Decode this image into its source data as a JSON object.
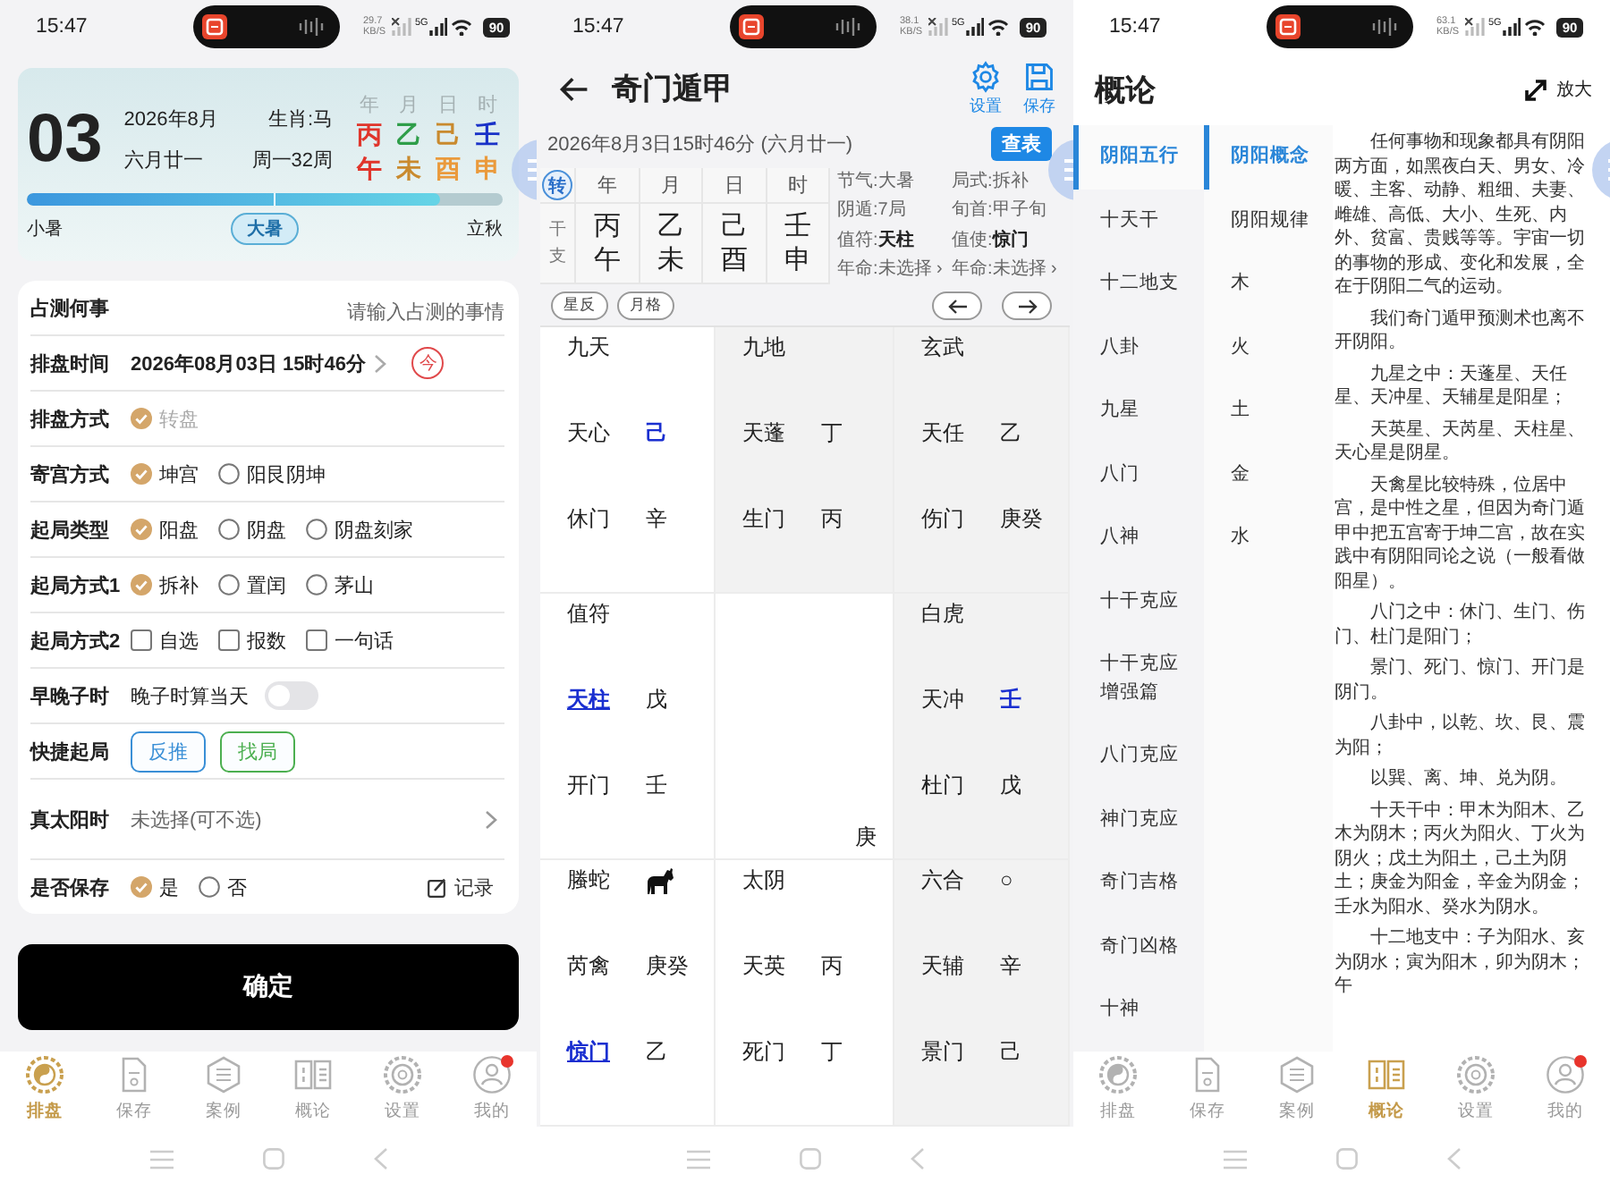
{
  "home_screen": {
    "status_bar": {
      "time": "15:47",
      "speed": "29.7",
      "speed_unit": "KB/S",
      "network_type": "5G",
      "battery": "90"
    },
    "date_card": {
      "day": "03",
      "month": "2026年8月",
      "lunar": "六月廿一",
      "zodiac": "生肖:马",
      "week": "周一32周",
      "pillars": [
        {
          "head": "年",
          "stem": {
            "text": "丙",
            "color": "#e0352b"
          },
          "branch": {
            "text": "午",
            "color": "#e0352b"
          }
        },
        {
          "head": "月",
          "stem": {
            "text": "乙",
            "color": "#2f9e4a"
          },
          "branch": {
            "text": "未",
            "color": "#c98a2e"
          }
        },
        {
          "head": "日",
          "stem": {
            "text": "己",
            "color": "#c98a2e"
          },
          "branch": {
            "text": "酉",
            "color": "#ea9a3c"
          }
        },
        {
          "head": "时",
          "stem": {
            "text": "壬",
            "color": "#1a32c8"
          },
          "branch": {
            "text": "申",
            "color": "#ea9a3c"
          }
        }
      ],
      "progress": {
        "level": 0.87
      },
      "terms": [
        {
          "label": "小暑",
          "selected": false
        },
        {
          "label": "大暑",
          "selected": true
        },
        {
          "label": "立秋",
          "selected": false
        }
      ]
    },
    "form": [
      {
        "kind": "input",
        "label": "占测何事",
        "placeholder": "请输入占测的事情"
      },
      {
        "kind": "datetime",
        "label": "排盘时间",
        "value": "2026年08月03日 15时46分",
        "button": "今"
      },
      {
        "kind": "radio",
        "label": "排盘方式",
        "options": [
          {
            "label": "转盘",
            "selected": true,
            "disabled": true
          }
        ]
      },
      {
        "kind": "radio",
        "label": "寄宫方式",
        "options": [
          {
            "label": "坤宫",
            "selected": true,
            "disabled": false
          },
          {
            "label": "阳艮阴坤",
            "selected": false,
            "disabled": false
          }
        ]
      },
      {
        "kind": "radio",
        "label": "起局类型",
        "options": [
          {
            "label": "阳盘",
            "selected": true,
            "disabled": false
          },
          {
            "label": "阴盘",
            "selected": false,
            "disabled": false
          },
          {
            "label": "阴盘刻家",
            "selected": false,
            "disabled": false
          }
        ]
      },
      {
        "kind": "radio",
        "label": "起局方式1",
        "options": [
          {
            "label": "拆补",
            "selected": true,
            "disabled": false
          },
          {
            "label": "置闰",
            "selected": false,
            "disabled": false
          },
          {
            "label": "茅山",
            "selected": false,
            "disabled": false
          }
        ]
      },
      {
        "kind": "checkbox",
        "label": "起局方式2",
        "options": [
          {
            "label": "自选",
            "checked": false
          },
          {
            "label": "报数",
            "checked": false
          },
          {
            "label": "一句话",
            "checked": false
          }
        ]
      },
      {
        "kind": "toggle",
        "label": "早晚子时",
        "text": "晚子时算当天",
        "on": false
      },
      {
        "kind": "buttons",
        "label": "快捷起局",
        "buttons": [
          {
            "label": "反推",
            "color": "#3a8fd6"
          },
          {
            "label": "找局",
            "color": "#4caf50"
          }
        ]
      },
      {
        "kind": "select",
        "label": "真太阳时",
        "placeholder": "未选择(可不选)"
      },
      {
        "kind": "radio",
        "label": "是否保存",
        "options": [
          {
            "label": "是",
            "selected": true,
            "disabled": false
          },
          {
            "label": "否",
            "selected": false,
            "disabled": false
          }
        ],
        "link": "记录"
      }
    ],
    "confirm_button": "确定",
    "tab_bar": [
      {
        "kind": "taiji",
        "label": "排盘",
        "selected": true,
        "badge": false
      },
      {
        "kind": "document",
        "label": "保存",
        "selected": false,
        "badge": false
      },
      {
        "kind": "hexagon",
        "label": "案例",
        "selected": false,
        "badge": false
      },
      {
        "kind": "book",
        "label": "概论",
        "selected": false,
        "badge": false
      },
      {
        "kind": "gear",
        "label": "设置",
        "selected": false,
        "badge": false
      },
      {
        "kind": "user",
        "label": "我的",
        "selected": false,
        "badge": true
      }
    ]
  },
  "chart_screen": {
    "status_bar": {
      "time": "15:47",
      "speed": "38.1",
      "speed_unit": "KB/S",
      "network_type": "5G",
      "battery": "90"
    },
    "title": "奇门遁甲",
    "actions": [
      {
        "kind": "gear",
        "label": "设置"
      },
      {
        "kind": "save",
        "label": "保存"
      }
    ],
    "datetime": "2026年8月3日15时46分 (六月廿一)",
    "lookup_button": "查表",
    "switch_button": "转",
    "row_label": "干支",
    "pillars": [
      {
        "head": "年",
        "stem": "丙",
        "branch": "午"
      },
      {
        "head": "月",
        "stem": "乙",
        "branch": "未"
      },
      {
        "head": "日",
        "stem": "己",
        "branch": "酉"
      },
      {
        "head": "时",
        "stem": "壬",
        "branch": "申"
      }
    ],
    "info": [
      "节气:大暑",
      "局式:拆补",
      "阴遁:7局",
      "旬首:甲子旬",
      "值符:**天柱**",
      "值使:**惊门**",
      "年命:未选择 ›",
      "年命:未选择 ›"
    ],
    "tags": [
      "星反",
      "月格"
    ],
    "palaces": [
      {
        "kind": "outer",
        "god": "九天",
        "star": "天心",
        "star_stem": "己",
        "door": "休门",
        "door_stem": "辛",
        "shaded": false,
        "star_highlight": false,
        "star_stem_highlight": true,
        "door_highlight": false
      },
      {
        "kind": "outer",
        "god": "九地",
        "star": "天蓬",
        "star_stem": "丁",
        "door": "生门",
        "door_stem": "丙",
        "shaded": true,
        "star_highlight": false,
        "star_stem_highlight": false,
        "door_highlight": false
      },
      {
        "kind": "outer",
        "god": "玄武",
        "star": "天任",
        "star_stem": "乙",
        "door": "伤门",
        "door_stem": "庚癸",
        "shaded": true,
        "star_highlight": false,
        "star_stem_highlight": false,
        "door_highlight": false
      },
      {
        "kind": "outer",
        "god": "值符",
        "star": "天柱",
        "star_stem": "戊",
        "door": "开门",
        "door_stem": "壬",
        "shaded": false,
        "star_highlight": true,
        "star_stem_highlight": false,
        "door_highlight": false
      },
      {
        "kind": "center",
        "stem": "庚",
        "shaded": false
      },
      {
        "kind": "outer",
        "god": "白虎",
        "star": "天冲",
        "star_stem": "壬",
        "door": "杜门",
        "door_stem": "戊",
        "shaded": true,
        "star_highlight": false,
        "star_stem_highlight": true,
        "door_highlight": false
      },
      {
        "kind": "outer",
        "god": "螣蛇",
        "mark": {
          "kind": "horse"
        },
        "star": "芮禽",
        "star_stem": "庚癸",
        "door": "惊门",
        "door_stem": "乙",
        "shaded": false,
        "star_highlight": false,
        "star_stem_highlight": false,
        "door_highlight": true
      },
      {
        "kind": "outer",
        "god": "太阴",
        "star": "天英",
        "star_stem": "丙",
        "door": "死门",
        "door_stem": "丁",
        "shaded": false,
        "star_highlight": false,
        "star_stem_highlight": false,
        "door_highlight": false
      },
      {
        "kind": "outer",
        "god": "六合",
        "mark": {
          "kind": "text",
          "text": "○"
        },
        "star": "天辅",
        "star_stem": "辛",
        "door": "景门",
        "door_stem": "己",
        "shaded": true,
        "star_highlight": false,
        "star_stem_highlight": false,
        "door_highlight": false
      }
    ]
  },
  "overview_screen": {
    "status_bar": {
      "time": "15:47",
      "speed": "63.1",
      "speed_unit": "KB/S",
      "network_type": "5G",
      "battery": "90"
    },
    "title": "概论",
    "zoom_button": "放大",
    "categories": [
      {
        "label": "阴阳五行",
        "selected": true
      },
      {
        "label": "十天干",
        "selected": false
      },
      {
        "label": "十二地支",
        "selected": false
      },
      {
        "label": "八卦",
        "selected": false
      },
      {
        "label": "九星",
        "selected": false
      },
      {
        "label": "八门",
        "selected": false
      },
      {
        "label": "八神",
        "selected": false
      },
      {
        "label": "十干克应",
        "selected": false
      },
      {
        "label": "十干克应增强篇",
        "selected": false
      },
      {
        "label": "八门克应",
        "selected": false
      },
      {
        "label": "神门克应",
        "selected": false
      },
      {
        "label": "奇门吉格",
        "selected": false
      },
      {
        "label": "奇门凶格",
        "selected": false
      },
      {
        "label": "十神",
        "selected": false
      }
    ],
    "topics": [
      {
        "label": "阴阳概念",
        "selected": true
      },
      {
        "label": "阴阳规律",
        "selected": false
      },
      {
        "label": "木",
        "selected": false
      },
      {
        "label": "火",
        "selected": false
      },
      {
        "label": "土",
        "selected": false
      },
      {
        "label": "金",
        "selected": false
      },
      {
        "label": "水",
        "selected": false
      }
    ],
    "paragraphs": [
      "任何事物和现象都具有阴阳两方面，如黑夜白天、男女、冷暖、主客、动静、粗细、夫妻、雌雄、高低、大小、生死、内外、贫富、贵贱等等。宇宙一切的事物的形成、变化和发展，全在于阴阳二气的运动。",
      "我们奇门遁甲预测术也离不开阴阳。",
      "九星之中：天蓬星、天任星、天冲星、天辅星是阳星；",
      "天英星、天芮星、天柱星、天心星是阴星。",
      "天禽星比较特殊，位居中宫，是中性之星，但因为奇门遁甲中把五宫寄于坤二宫，故在实践中有阴阳同论之说（一般看做阳星）。",
      "八门之中：休门、生门、伤门、杜门是阳门；",
      "景门、死门、惊门、开门是阴门。",
      "八卦中，以乾、坎、艮、震为阳；",
      "以巽、离、坤、兑为阴。",
      "十天干中：甲木为阳木、乙木为阴木；丙火为阳火、丁火为阴火；戊土为阳土，己土为阴土；庚金为阳金，辛金为阴金；壬水为阳水、癸水为阴水。",
      "十二地支中：子为阳水、亥为阴水；寅为阳木，卯为阴木；午"
    ],
    "tab_bar": [
      {
        "kind": "taiji",
        "label": "排盘",
        "selected": false,
        "badge": false
      },
      {
        "kind": "document",
        "label": "保存",
        "selected": false,
        "badge": false
      },
      {
        "kind": "hexagon",
        "label": "案例",
        "selected": false,
        "badge": false
      },
      {
        "kind": "book",
        "label": "概论",
        "selected": true,
        "badge": false
      },
      {
        "kind": "gear",
        "label": "设置",
        "selected": false,
        "badge": false
      },
      {
        "kind": "user",
        "label": "我的",
        "selected": false,
        "badge": true
      }
    ]
  }
}
